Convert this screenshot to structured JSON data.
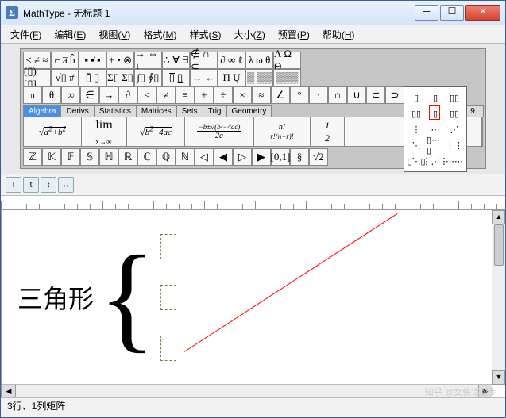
{
  "window": {
    "title": "MathType - 无标题 1"
  },
  "menu": {
    "file": {
      "label": "文件",
      "u": "F"
    },
    "edit": {
      "label": "编辑",
      "u": "E"
    },
    "view": {
      "label": "视图",
      "u": "V"
    },
    "format": {
      "label": "格式",
      "u": "M"
    },
    "style": {
      "label": "样式",
      "u": "S"
    },
    "size": {
      "label": "大小",
      "u": "Z"
    },
    "prefs": {
      "label": "预置",
      "u": "P"
    },
    "help": {
      "label": "帮助",
      "u": "H"
    }
  },
  "palette": {
    "row1": [
      "≤ ≠ ≈",
      "⌐ a̅ b̂",
      "▪ ▪̇ ▪",
      "± • ⊗",
      "→ ⇔ ↓",
      "∴ ∀ ∃",
      "∉ ∩ ⊂",
      "∂ ∞ ℓ",
      "λ ω θ",
      "Λ Ω Θ"
    ],
    "row2": [
      "(▯) [▯]",
      "√▯ #̄",
      "▯̄ ▯̱",
      "Σ▯ Σ▯",
      "∫▯ ∮▯",
      "▯̅ ▯̲",
      "→ ←",
      "Π Ų",
      "▒ ▒▒",
      "▒▒▒"
    ],
    "row3": [
      "π",
      "θ",
      "∞",
      "∈",
      "→",
      "∂",
      "≤",
      "≠",
      "≡",
      "±",
      "÷",
      "×",
      "≈",
      "∠",
      "°",
      "·",
      "∩",
      "∪",
      "⊂",
      "⊃"
    ],
    "tabs": [
      "Algebra",
      "Derivs",
      "Statistics",
      "Matrices",
      "Sets",
      "Trig",
      "Geometry"
    ],
    "tab_nums": [
      "▯",
      "▯",
      "9"
    ],
    "exprs": {
      "sqrt_sum": "√(a²+b²)",
      "lim": "lim",
      "lim_sub": "x→∞",
      "sqrt_disc": "√(b²−4ac)",
      "quad": "−b±√(b²−4ac)",
      "quad_den": "2a",
      "fact": "n!",
      "fact_den": "r!(n−r)!",
      "half": "1",
      "half_den": "2"
    },
    "row4": [
      "ℤ",
      "𝕂",
      "𝔽",
      "𝕊",
      "ℍ",
      "ℝ",
      "ℂ",
      "ℚ",
      "ℕ",
      "◁",
      "◀",
      "▷",
      "▶",
      "[0,1]",
      "§",
      "√2"
    ]
  },
  "editor": {
    "formula_label": "三角形"
  },
  "status": {
    "text": "3行、1列矩阵"
  },
  "watermark": {
    "text": "知乎 @女侠请留步"
  }
}
